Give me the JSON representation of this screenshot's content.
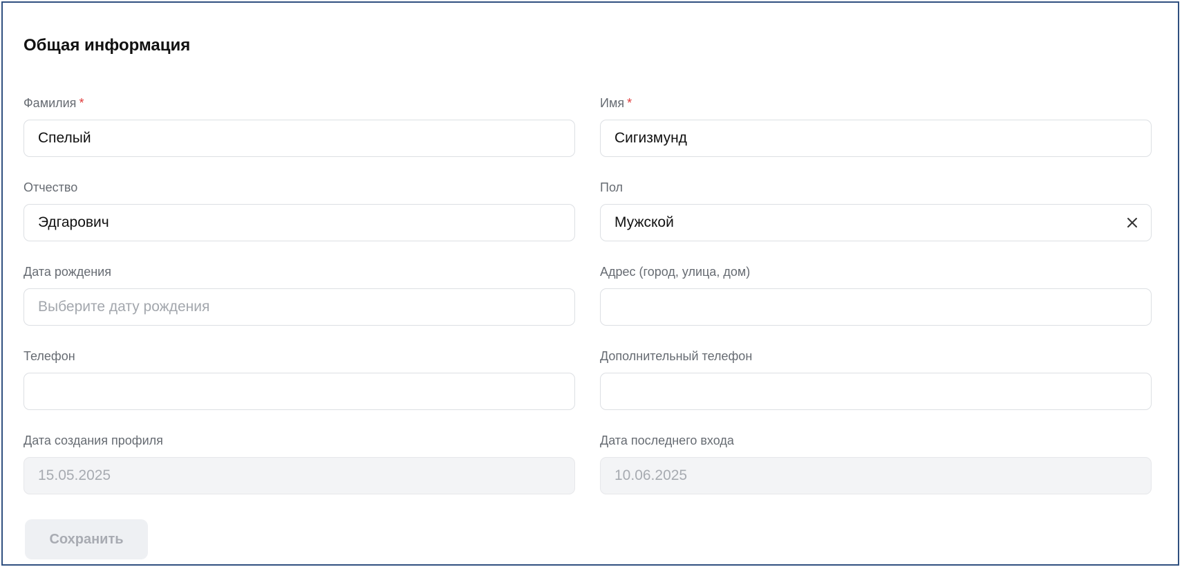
{
  "form": {
    "title": "Общая информация",
    "required_mark": "*",
    "fields": {
      "last_name": {
        "label": "Фамилия",
        "value": "Спелый"
      },
      "first_name": {
        "label": "Имя",
        "value": "Сигизмунд"
      },
      "middle_name": {
        "label": "Отчество",
        "value": "Эдгарович"
      },
      "gender": {
        "label": "Пол",
        "value": "Мужской"
      },
      "birth_date": {
        "label": "Дата рождения",
        "placeholder": "Выберите дату рождения",
        "value": ""
      },
      "address": {
        "label": "Адрес (город, улица, дом)",
        "value": ""
      },
      "phone": {
        "label": "Телефон",
        "value": ""
      },
      "extra_phone": {
        "label": "Дополнительный телефон",
        "value": ""
      },
      "created_date": {
        "label": "Дата создания профиля",
        "value": "15.05.2025"
      },
      "last_login": {
        "label": "Дата последнего входа",
        "value": "10.06.2025"
      }
    },
    "save_label": "Сохранить"
  },
  "icons": {
    "clear": "close-icon"
  },
  "colors": {
    "frame_border": "#2f4f7f",
    "required": "#e03a3a",
    "disabled_bg": "#f3f4f6"
  }
}
